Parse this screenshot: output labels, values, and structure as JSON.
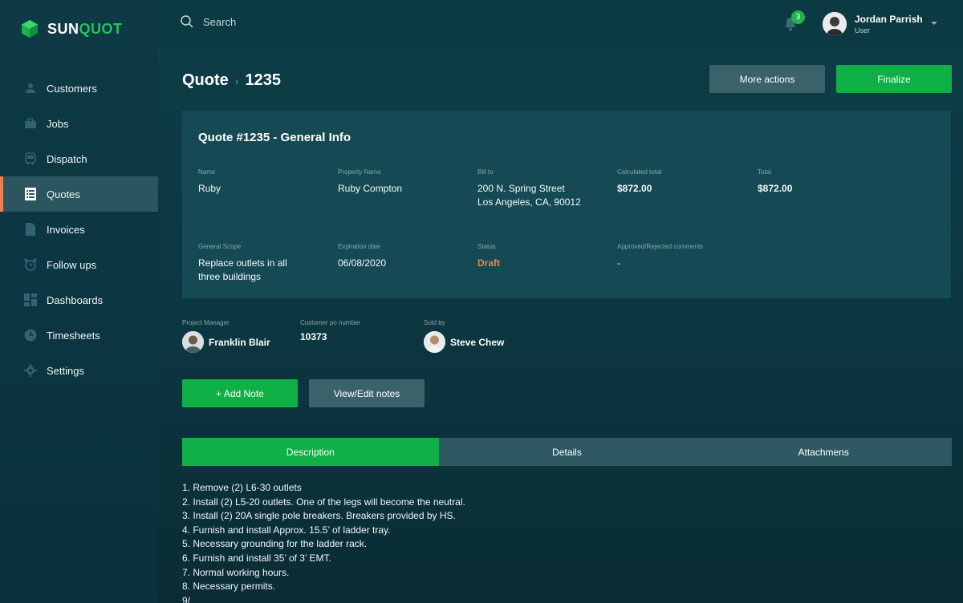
{
  "brand": {
    "name_part1": "SUN",
    "name_part2": "QUOT"
  },
  "sidebar": {
    "items": [
      {
        "label": "Customers",
        "icon": "user-icon"
      },
      {
        "label": "Jobs",
        "icon": "briefcase-icon"
      },
      {
        "label": "Dispatch",
        "icon": "bus-icon"
      },
      {
        "label": "Quotes",
        "icon": "list-icon",
        "active": true
      },
      {
        "label": "Invoices",
        "icon": "document-icon"
      },
      {
        "label": "Follow ups",
        "icon": "alarm-clock-icon"
      },
      {
        "label": "Dashboards",
        "icon": "grid-icon"
      },
      {
        "label": "Timesheets",
        "icon": "clock-icon"
      },
      {
        "label": "Settings",
        "icon": "gear-icon"
      }
    ]
  },
  "topbar": {
    "search_placeholder": "Search",
    "notification_count": "3",
    "user": {
      "name": "Jordan Parrish",
      "role": "User"
    }
  },
  "page": {
    "breadcrumb_root": "Quote",
    "breadcrumb_current": "1235",
    "more_actions_label": "More actions",
    "finalize_label": "Finalize"
  },
  "card": {
    "title": "Quote #1235 - General Info",
    "fields": {
      "name": {
        "label": "Name",
        "value": "Ruby"
      },
      "property_name": {
        "label": "Property Name",
        "value": "Ruby Compton"
      },
      "bill_to": {
        "label": "Bill to",
        "line1": "200 N. Spring Street",
        "line2": "Los Angeles, CA, 90012"
      },
      "calculated_total": {
        "label": "Calculated total",
        "value": "$872.00"
      },
      "total": {
        "label": "Total",
        "value": "$872.00"
      },
      "general_scope": {
        "label": "General Scope",
        "line1": "Replace outlets in all",
        "line2": "three buildings"
      },
      "expiration_date": {
        "label": "Expiration date",
        "value": "06/08/2020"
      },
      "status": {
        "label": "Status",
        "value": "Draft"
      },
      "comments": {
        "label": "Approved/Rejected comments",
        "value": "-"
      }
    }
  },
  "people": {
    "project_manager": {
      "label": "Project Manager",
      "name": "Franklin Blair"
    },
    "customer_po": {
      "label": "Customer po number",
      "value": "10373"
    },
    "sold_by": {
      "label": "Sold by",
      "name": "Steve Chew"
    }
  },
  "notes": {
    "add_label": "+ Add Note",
    "view_label": "View/Edit notes"
  },
  "tabs": [
    {
      "label": "Description",
      "active": true
    },
    {
      "label": "Details"
    },
    {
      "label": "Attachmens"
    }
  ],
  "description": [
    "1. Remove (2) L6-30 outlets",
    "2. Install (2) L5-20 outlets. One of the legs will become the neutral.",
    "3. Install (2) 20A single pole breakers. Breakers provided by HS.",
    "4. Furnish and install Approx. 15.5’ of ladder tray.",
    "5. Necessary grounding for the ladder rack.",
    "6. Furnish and install 35’ of 3’ EMT.",
    "7. Normal working hours.",
    "8. Necessary permits.",
    "9/"
  ],
  "colors": {
    "accent_green": "#0fb146",
    "accent_orange": "#ef7f4f",
    "status_draft": "#ef7f4f"
  }
}
